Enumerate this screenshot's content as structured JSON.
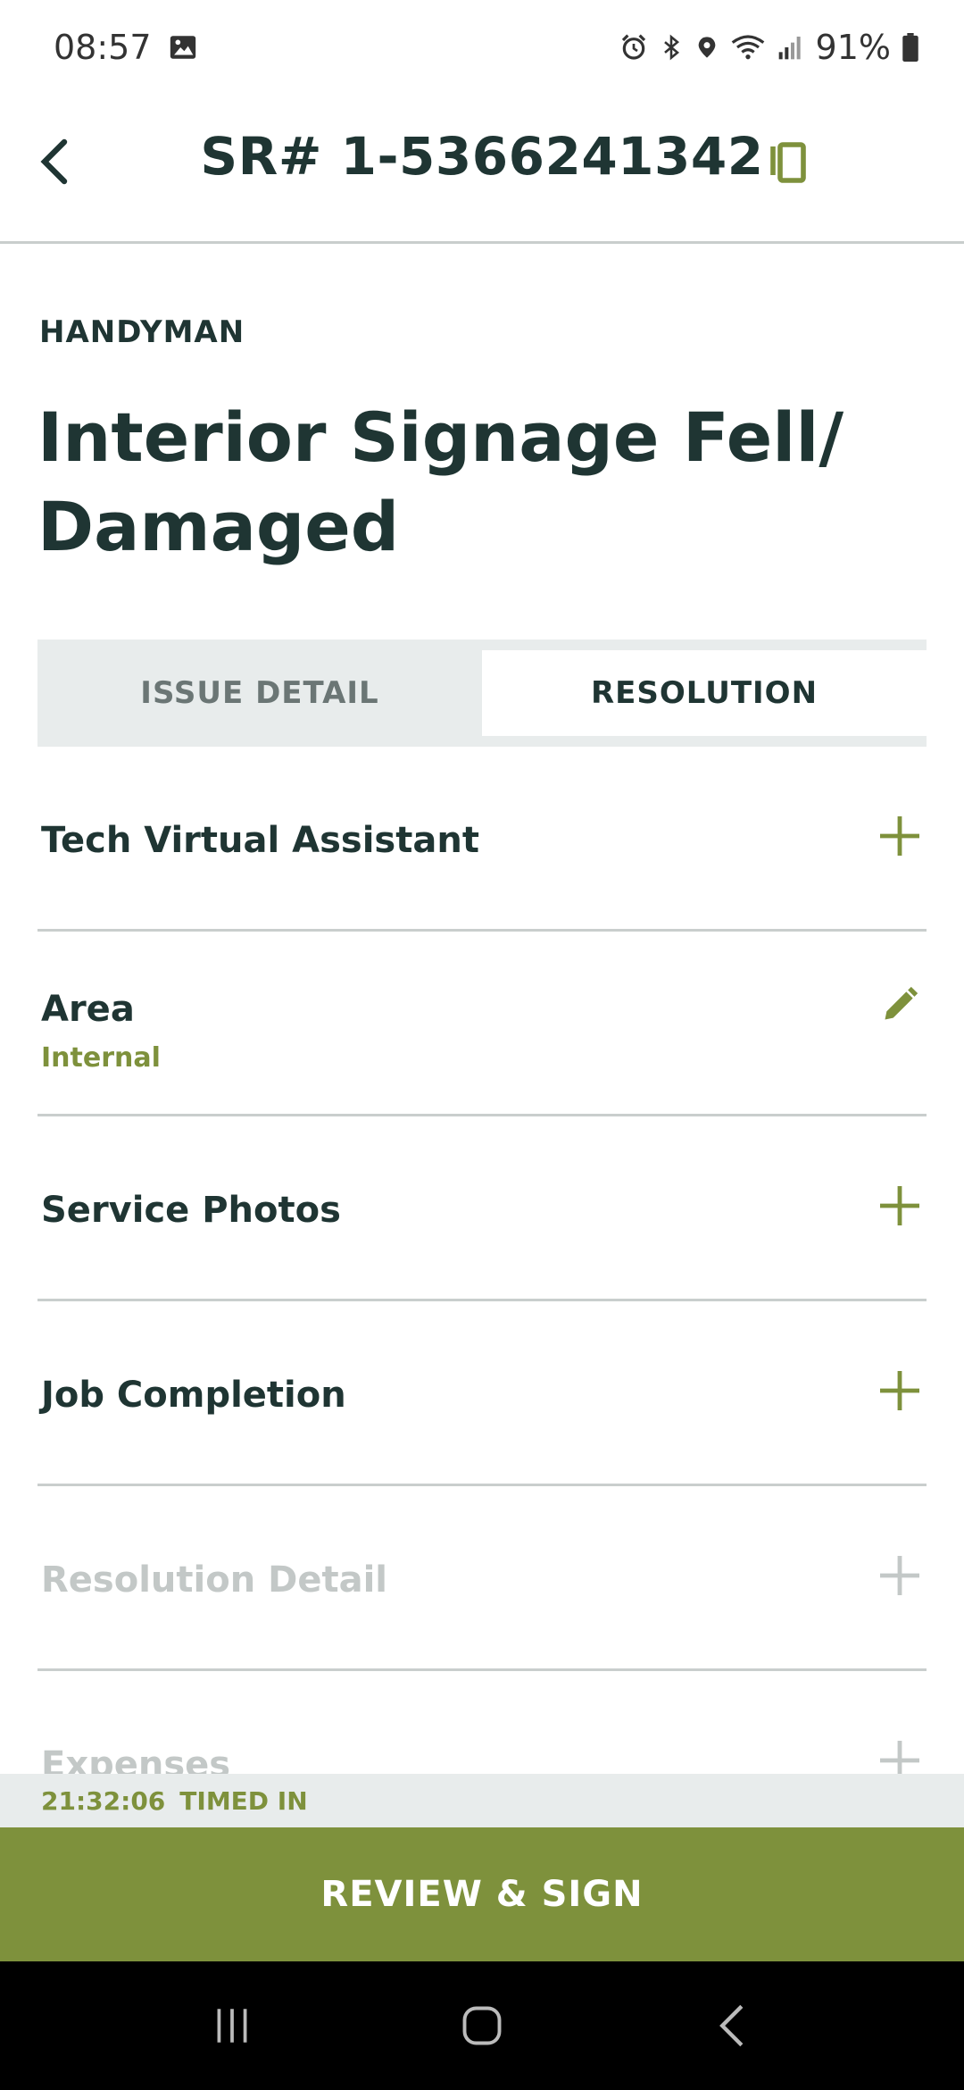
{
  "status_bar": {
    "time": "08:57",
    "battery": "91%",
    "icons": [
      "image-icon",
      "alarm-icon",
      "bluetooth-icon",
      "location-icon",
      "wifi-icon",
      "signal-icon",
      "battery-icon"
    ]
  },
  "header": {
    "title": "SR# 1-5366241342",
    "back_icon": "chevron-left-icon",
    "copy_icon": "copy-icon"
  },
  "ticket": {
    "category": "HANDYMAN",
    "title": "Interior Signage Fell/ Damaged"
  },
  "tabs": [
    {
      "label": "ISSUE DETAIL",
      "active": false
    },
    {
      "label": "RESOLUTION",
      "active": true
    }
  ],
  "sections": [
    {
      "title": "Tech Virtual Assistant",
      "action": "plus-icon"
    },
    {
      "title": "Area",
      "subtitle": "Internal",
      "action": "pencil-icon"
    },
    {
      "title": "Service Photos",
      "action": "plus-icon"
    },
    {
      "title": "Job Completion",
      "action": "plus-icon"
    },
    {
      "title": "Resolution Detail",
      "action": "plus-icon",
      "disabled": true
    },
    {
      "title": "Expenses",
      "action": "plus-icon",
      "disabled": true
    }
  ],
  "timer": {
    "elapsed": "21:32:06",
    "status": "TIMED IN"
  },
  "review_button": {
    "label": "REVIEW & SIGN"
  },
  "colors": {
    "accent": "#7e913c",
    "text_dark": "#1f3533",
    "tab_bg": "#e8ecec",
    "disabled_text": "#c3c8c7"
  }
}
